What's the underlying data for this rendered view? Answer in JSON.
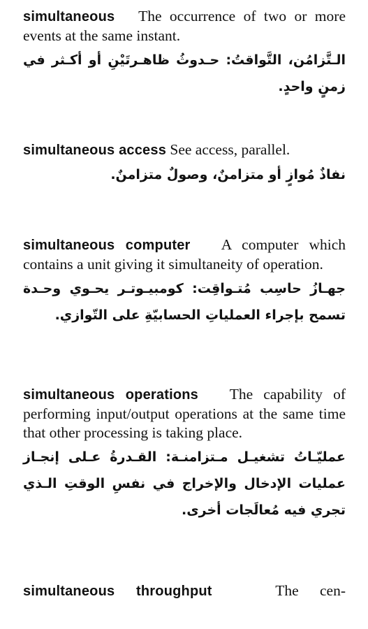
{
  "entries": [
    {
      "term": "simultaneous",
      "definition_en": "The occurrence of two or more events at the same instant.",
      "definition_ar": "الـتَّزامُن، التَّواقتُ: حـدوثُ ظاهـرتَيْنِ أو أكـثر في زمنٍ واحدٍ."
    },
    {
      "term": "simultaneous access",
      "definition_en": "See access, parallel.",
      "definition_ar": "نفاذٌ مُوازٍ أو متزامنٌ، وصولٌ متزامنٌ."
    },
    {
      "term": "simultaneous computer",
      "definition_en": "A computer which contains a unit giving it simultaneity of operation.",
      "definition_ar": "جهـازُ حاسِب مُتـواقِت: كومبيـوتـر يحـوي وحـدة تسمح بإجراء العملياتِ الحسابيّةِ على التّوازي."
    },
    {
      "term": "simultaneous operations",
      "definition_en": "The capability of performing input/output operations at the same time that other processing is taking place.",
      "definition_ar": "عمليّـاتُ تشغيـل مـتزامنـة: القـدرةُ عـلى إنجـاز عمليات الإدخال والإخراج في نفسِ الوقتِ الـذي تجري فيه مُعالَجات أخرى."
    },
    {
      "term": "simultaneous throughput",
      "definition_en": "The cen-",
      "definition_ar": ""
    }
  ]
}
